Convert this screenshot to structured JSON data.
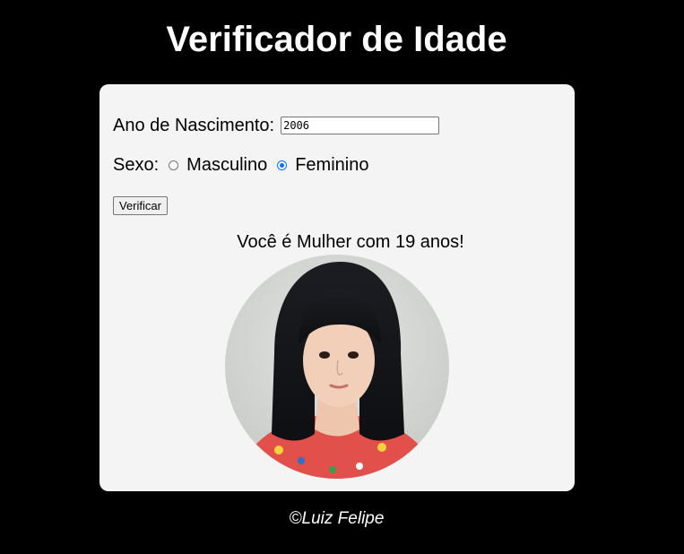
{
  "header": {
    "title": "Verificador de Idade"
  },
  "form": {
    "year_label": "Ano de Nascimento:",
    "year_value": "2006",
    "sex_label": "Sexo:",
    "options": [
      {
        "label": "Masculino",
        "checked": false
      },
      {
        "label": "Feminino",
        "checked": true
      }
    ],
    "verify_label": "Verificar"
  },
  "result": {
    "text": "Você é Mulher com 19 anos!",
    "photo_icon": "portrait-photo"
  },
  "footer": {
    "text": "©Luiz Felipe"
  },
  "colors": {
    "page_background": "#000000",
    "panel_background": "#f4f4f4",
    "radio_accent": "#0075ff"
  }
}
